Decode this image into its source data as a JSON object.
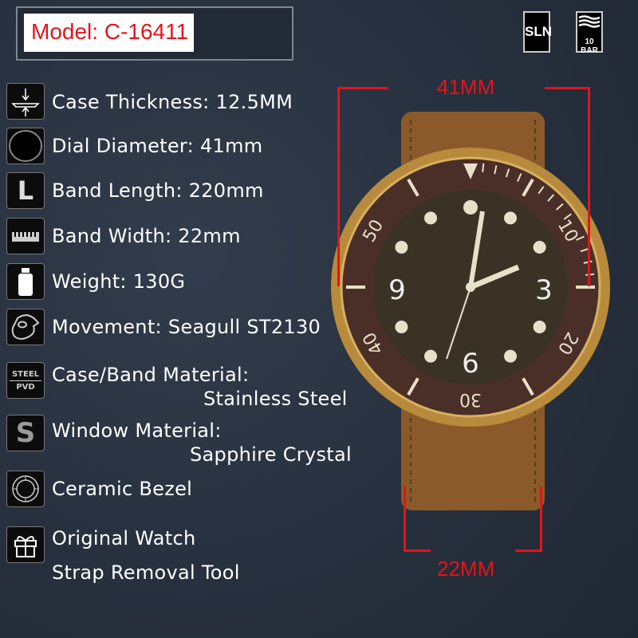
{
  "model": "Model: C-16411",
  "badges": {
    "lume": "SLN",
    "water": "10 BAR"
  },
  "specs": [
    {
      "icon": "case-thickness-icon",
      "lines": [
        "Case Thickness: 12.5MM"
      ]
    },
    {
      "icon": "dial-diameter-icon",
      "lines": [
        "Dial Diameter: 41mm"
      ]
    },
    {
      "icon": "band-length-icon",
      "icon_text": "L",
      "lines": [
        "Band Length: 220mm"
      ]
    },
    {
      "icon": "band-width-ruler-icon",
      "lines": [
        "Band Width: 22mm"
      ]
    },
    {
      "icon": "weight-icon",
      "lines": [
        "Weight: 130G"
      ]
    },
    {
      "icon": "movement-icon",
      "lines": [
        "Movement: Seagull ST2130"
      ]
    },
    {
      "icon": "steel-pvd-icon",
      "icon_text": [
        "STEEL",
        "PVD"
      ],
      "lines": [
        "Case/Band Material:",
        "Stainless Steel"
      ]
    },
    {
      "icon": "sapphire-icon",
      "icon_text": "S",
      "lines": [
        "Window Material:",
        "Sapphire Crystal"
      ]
    },
    {
      "icon": "ceramic-bezel-icon",
      "lines": [
        "Ceramic Bezel"
      ]
    },
    {
      "icon": "gift-icon",
      "lines": [
        "Original Watch",
        "Strap Removal Tool"
      ]
    }
  ],
  "dimensions": {
    "case": "41MM",
    "strap": "22MM"
  },
  "watch": {
    "numerals": [
      "3",
      "6",
      "9"
    ],
    "bezel_marks": [
      "10",
      "20",
      "30",
      "40",
      "50"
    ]
  },
  "colors": {
    "accent": "#e3141b",
    "bronze": "#c9a04a",
    "bezel": "#4a2f28",
    "strap": "#8a5a2b"
  }
}
